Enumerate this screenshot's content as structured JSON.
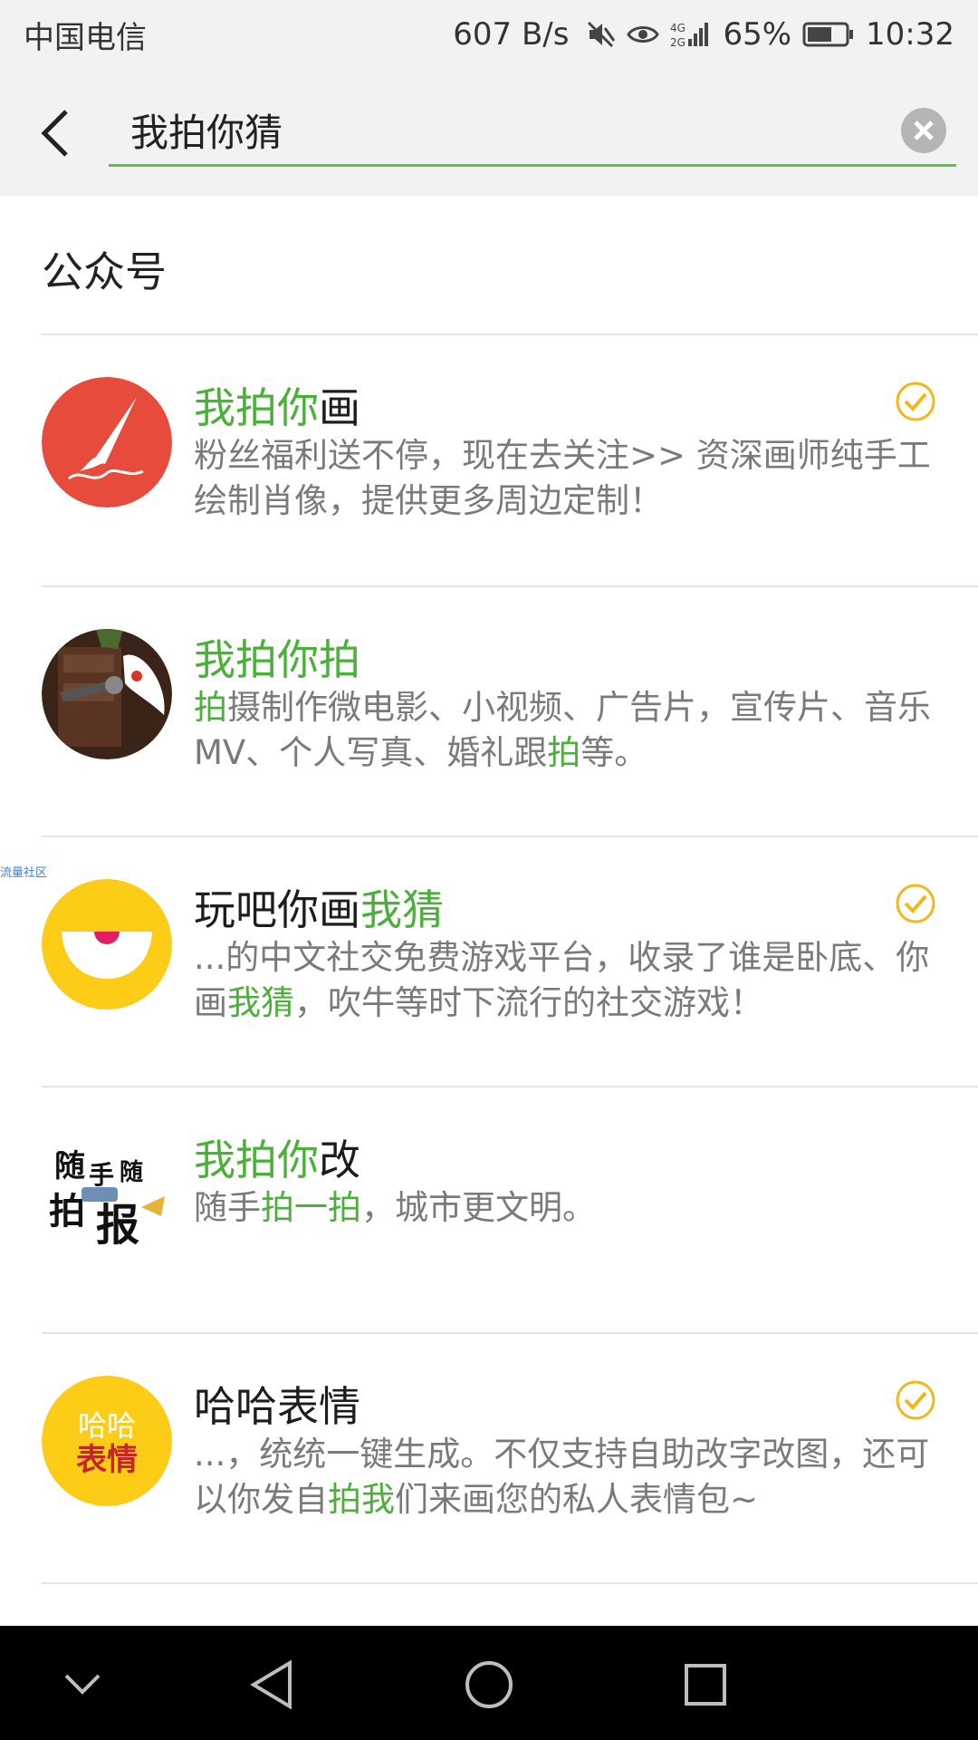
{
  "status_bar": {
    "carrier": "中国电信",
    "net_speed": "607 B/s",
    "network": "4G 2G",
    "battery": "65%",
    "battery_level": 0.65,
    "time": "10:32"
  },
  "search": {
    "query": "我拍你猜"
  },
  "section": {
    "title": "公众号"
  },
  "results": [
    {
      "title": [
        {
          "t": "我拍你",
          "hl": true
        },
        {
          "t": "画",
          "hl": false
        }
      ],
      "desc": [
        {
          "t": "粉丝福利送不停，现在去关注>> 资深画师纯手工绘制肖像，提供更多周边定制！",
          "hl": false
        }
      ],
      "verified": true,
      "avatar": "paintbrush-logo"
    },
    {
      "title": [
        {
          "t": "我拍你拍",
          "hl": true
        }
      ],
      "desc": [
        {
          "t": "拍",
          "hl": true
        },
        {
          "t": "摄制作微电影、小视频、广告片，宣传片、音乐MV、个人写真、婚礼跟",
          "hl": false
        },
        {
          "t": "拍",
          "hl": true
        },
        {
          "t": "等。",
          "hl": false
        }
      ],
      "verified": false,
      "avatar": "camera-photo"
    },
    {
      "title": [
        {
          "t": "玩吧你画",
          "hl": false
        },
        {
          "t": "我猜",
          "hl": true
        }
      ],
      "desc": [
        {
          "t": "...的中文社交免费游戏平台，收录了谁是卧底、你画",
          "hl": false
        },
        {
          "t": "我猜",
          "hl": true
        },
        {
          "t": "，吹牛等时下流行的社交游戏！",
          "hl": false
        }
      ],
      "verified": true,
      "avatar": "yellow-face-logo"
    },
    {
      "title": [
        {
          "t": "我拍你",
          "hl": true
        },
        {
          "t": "改",
          "hl": false
        }
      ],
      "desc": [
        {
          "t": "随手",
          "hl": false
        },
        {
          "t": "拍一拍",
          "hl": true
        },
        {
          "t": "，城市更文明。",
          "hl": false
        }
      ],
      "verified": false,
      "avatar": "suishou-paibao-logo",
      "avatar_text": [
        "随",
        "手",
        "随",
        "拍",
        "报"
      ]
    },
    {
      "title": [
        {
          "t": "哈哈表情",
          "hl": false
        }
      ],
      "desc": [
        {
          "t": "...，统统一键生成。不仅支持自助改字改图，还可以你发自",
          "hl": false
        },
        {
          "t": "拍我",
          "hl": true
        },
        {
          "t": "们来画您的私人表情包~",
          "hl": false
        }
      ],
      "verified": true,
      "avatar": "haha-emoji-logo",
      "avatar_text": [
        "哈哈",
        "表情"
      ]
    }
  ],
  "watermark": "流量社区",
  "nav": [
    "collapse-icon",
    "back-triangle-icon",
    "home-circle-icon",
    "recents-square-icon"
  ],
  "colors": {
    "accent": "#4bb03a",
    "verified": "#f0b81d"
  }
}
